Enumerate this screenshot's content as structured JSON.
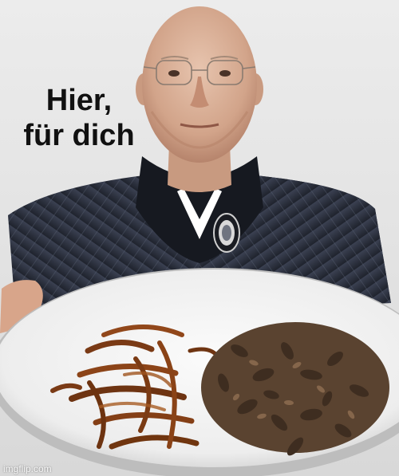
{
  "caption": {
    "line1": "Hier,",
    "line2": "für dich"
  },
  "watermark": "imgflip.com",
  "colors": {
    "background": "#e6e6e6",
    "jacket": "#2f3442",
    "plate": "#f4f4f4",
    "mealworms": "#7a3a15",
    "crickets": "#5a4330"
  }
}
